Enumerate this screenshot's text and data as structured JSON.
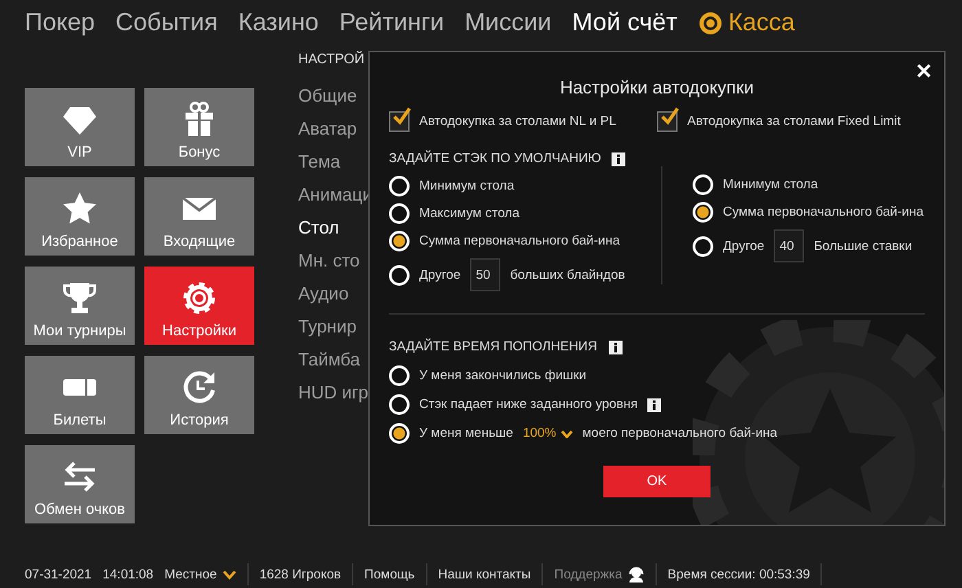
{
  "nav": [
    {
      "label": "Покер",
      "kind": "link",
      "selected": false
    },
    {
      "label": "События",
      "kind": "link",
      "selected": false
    },
    {
      "label": "Казино",
      "kind": "link",
      "selected": false
    },
    {
      "label": "Рейтинги",
      "kind": "link",
      "selected": false
    },
    {
      "label": "Миссии",
      "kind": "link",
      "selected": false
    },
    {
      "label": "Мой счёт",
      "kind": "link",
      "selected": true
    },
    {
      "label": "Касса",
      "kind": "cashier",
      "selected": false
    }
  ],
  "tiles": [
    {
      "label": "VIP",
      "selected": false
    },
    {
      "label": "Бонус",
      "selected": false
    },
    {
      "label": "Избранное",
      "selected": false
    },
    {
      "label": "Входящие",
      "selected": false
    },
    {
      "label": "Мои турниры",
      "selected": false
    },
    {
      "label": "Настройки",
      "selected": true
    },
    {
      "label": "Билеты",
      "selected": false
    },
    {
      "label": "История",
      "selected": false
    },
    {
      "label": "Обмен очков",
      "selected": false
    }
  ],
  "settings_menu": {
    "heading": "НАСТРОЙ",
    "items": [
      {
        "label": "Общие",
        "selected": false
      },
      {
        "label": "Аватар",
        "selected": false
      },
      {
        "label": "Тема",
        "selected": false
      },
      {
        "label": "Анимаци",
        "selected": false
      },
      {
        "label": "Стол",
        "selected": true
      },
      {
        "label": "Мн. сто",
        "selected": false
      },
      {
        "label": "Аудио",
        "selected": false
      },
      {
        "label": "Турнир",
        "selected": false
      },
      {
        "label": "Таймба",
        "selected": false
      },
      {
        "label": "HUD игр",
        "selected": false
      }
    ]
  },
  "dialog": {
    "title": "Настройки автодокупки",
    "close": "✕",
    "checkboxes": [
      {
        "label": "Автодокупка за столами NL и PL",
        "checked": true
      },
      {
        "label": "Автодокупка за столами Fixed Limit",
        "checked": true
      }
    ],
    "stack_section": {
      "heading": "ЗАДАЙТЕ СТЭК ПО УМОЛЧАНИЮ",
      "info": true,
      "left_options": [
        {
          "kind": "plain",
          "label": "Минимум стола",
          "selected": false
        },
        {
          "kind": "plain",
          "label": "Максимум стола",
          "selected": false
        },
        {
          "kind": "plain",
          "label": "Сумма первоначального бай-ина",
          "selected": true
        },
        {
          "kind": "input",
          "label": "Другое",
          "value": "50",
          "suffix": "больших блайндов",
          "selected": false
        }
      ],
      "right_options": [
        {
          "kind": "plain",
          "label": "Минимум стола",
          "selected": false
        },
        {
          "kind": "plain",
          "label": "Сумма первоначального бай-ина",
          "selected": true
        },
        {
          "kind": "input",
          "label": "Другое",
          "value": "40",
          "suffix": "Большие ставки",
          "selected": false
        }
      ]
    },
    "refill_section": {
      "heading": "ЗАДАЙТЕ ВРЕМЯ ПОПОЛНЕНИЯ",
      "info": true,
      "options": [
        {
          "kind": "plain",
          "label": "У меня закончились фишки",
          "selected": false,
          "info": false
        },
        {
          "kind": "plain",
          "label": "Стэк падает ниже заданного уровня",
          "selected": false,
          "info": true
        },
        {
          "kind": "dropdown",
          "label": "У меня меньше",
          "value": "100%",
          "suffix": "моего первоначального бай-ина",
          "selected": true,
          "info": false
        }
      ]
    },
    "ok_button": "OK"
  },
  "status_bar": [
    {
      "kind": "text",
      "label": "07-31-2021"
    },
    {
      "kind": "text",
      "label": "14:01:08"
    },
    {
      "kind": "dropdown",
      "label": "Местное"
    },
    {
      "kind": "sep"
    },
    {
      "kind": "text",
      "label": "1628 Игроков"
    },
    {
      "kind": "sep"
    },
    {
      "kind": "link",
      "label": "Помощь",
      "disabled": false
    },
    {
      "kind": "sep"
    },
    {
      "kind": "link",
      "label": "Наши контакты",
      "disabled": false
    },
    {
      "kind": "sep"
    },
    {
      "kind": "support",
      "label": "Поддержка",
      "disabled": true
    },
    {
      "kind": "sep"
    },
    {
      "kind": "text",
      "label": "Время сессии: 00:53:39"
    },
    {
      "kind": "sep"
    }
  ]
}
